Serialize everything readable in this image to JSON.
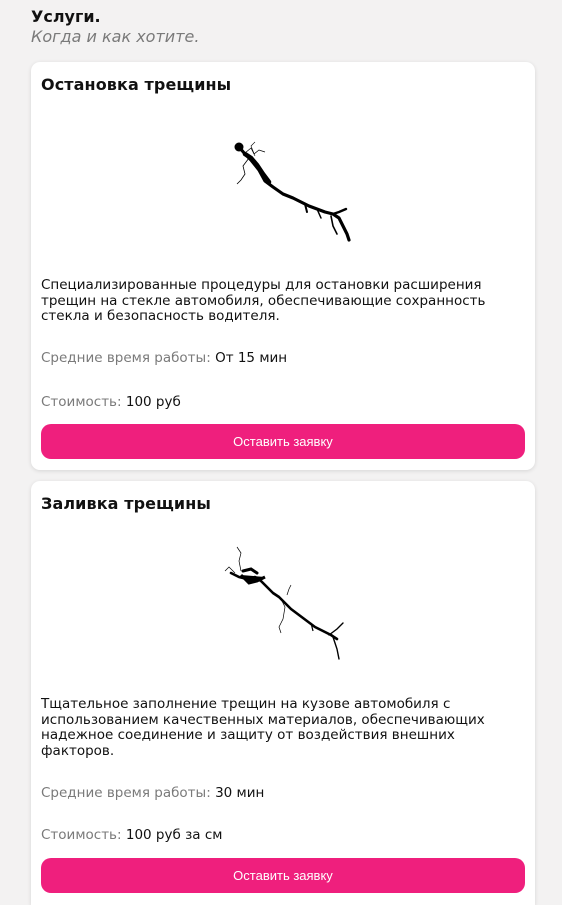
{
  "header": {
    "title": "Услуги.",
    "subtitle": "Когда и как хотите."
  },
  "services": [
    {
      "title": "Остановка трещины",
      "image_icon": "crack-image",
      "description": "Специализированные процедуры для остановки расширения трещин на стекле автомобиля, обеспечивающие сохранность стекла и безопасность водителя.",
      "time_label": "Средние время работы:",
      "time_value": "От 15 мин",
      "price_label": "Стоимость:",
      "price_value": "100 руб",
      "button_label": "Оставить заявку"
    },
    {
      "title": "Заливка трещины",
      "image_icon": "crack-image",
      "description": "Тщательное заполнение трещин на кузове автомобиля с использованием качественных материалов, обеспечивающих надежное соединение и защиту от воздействия внешних факторов.",
      "time_label": "Средние время работы:",
      "time_value": "30 мин",
      "price_label": "Стоимость:",
      "price_value": "100 руб за см",
      "button_label": "Оставить заявку"
    }
  ],
  "colors": {
    "accent": "#ef1f7d",
    "background": "#f3f2f2",
    "card": "#ffffff",
    "muted_text": "#7a7a7a"
  }
}
